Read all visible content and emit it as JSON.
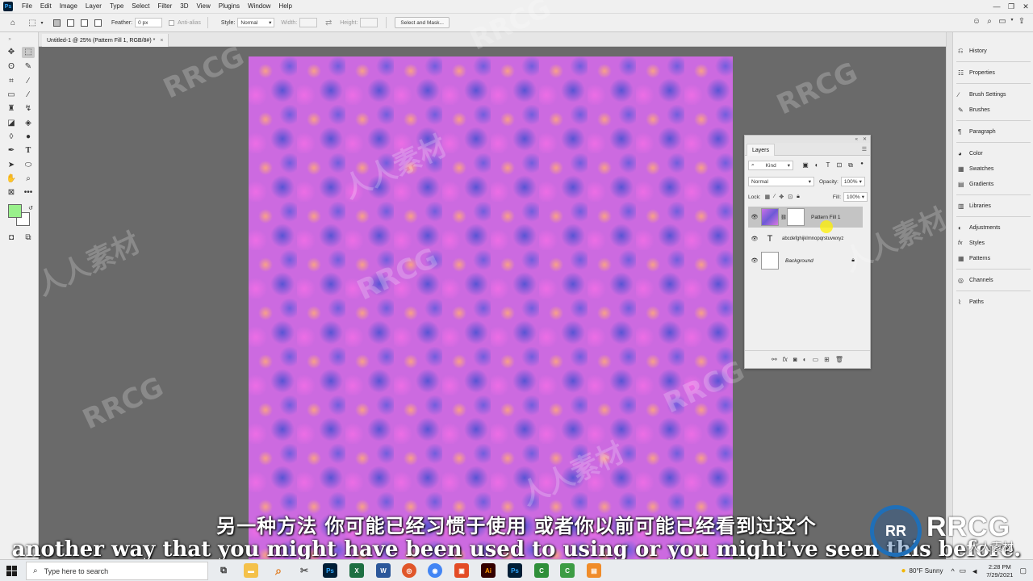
{
  "app": {
    "logo_text": "Ps"
  },
  "menubar": {
    "items": [
      "File",
      "Edit",
      "Image",
      "Layer",
      "Type",
      "Select",
      "Filter",
      "3D",
      "View",
      "Plugins",
      "Window",
      "Help"
    ],
    "window_controls": [
      "—",
      "❐",
      "✕"
    ]
  },
  "options_bar": {
    "feather_label": "Feather:",
    "feather_value": "0 px",
    "antialias_label": "Anti-alias",
    "style_label": "Style:",
    "style_value": "Normal",
    "width_label": "Width:",
    "height_label": "Height:",
    "select_mask_label": "Select and Mask..."
  },
  "document": {
    "tab_title": "Untitled-1 @ 25% (Pattern Fill 1, RGB/8#) *",
    "close": "×"
  },
  "toolbar": {
    "foreground_color": "#99f08b",
    "background_color": "#ffffff"
  },
  "layers_panel": {
    "title": "Layers",
    "filter_label": "Kind",
    "blend_mode": "Normal",
    "opacity_label": "Opacity:",
    "opacity_value": "100%",
    "lock_label": "Lock:",
    "fill_label": "Fill:",
    "fill_value": "100%",
    "layers": [
      {
        "name": "Pattern Fill 1",
        "type": "pattern-fill",
        "selected": true
      },
      {
        "name": "abcdefghijklmnopqrstuvwxyz",
        "type": "text",
        "selected": false
      },
      {
        "name": "Background",
        "type": "background",
        "selected": false,
        "locked": true
      }
    ]
  },
  "right_panels": {
    "groups": [
      [
        "History"
      ],
      [
        "Properties"
      ],
      [
        "Brush Settings",
        "Brushes"
      ],
      [
        "Paragraph"
      ],
      [
        "Color",
        "Swatches",
        "Gradients"
      ],
      [
        "Libraries"
      ],
      [
        "Adjustments",
        "Styles",
        "Patterns"
      ],
      [
        "Channels"
      ],
      [
        "Paths"
      ]
    ]
  },
  "subtitles": {
    "chinese": "另一种方法 你可能已经习惯于使用 或者你以前可能已经看到过这个",
    "english": "another way that you might have been used to using or you might've seen this before."
  },
  "watermark": {
    "text": "RRCG",
    "cn_text": "人人素材",
    "logo_text": "RRCG",
    "logo_sub": "人人素材",
    "logo_mark": "RR"
  },
  "taskbar": {
    "search_placeholder": "Type here to search",
    "weather": "80°F  Sunny",
    "time": "2:28 PM",
    "date": "7/29/2021"
  },
  "colors": {
    "canvas_pink": "#cc6ae0",
    "canvas_blue": "#4650d2",
    "canvas_peach": "#ffaa78",
    "accent": "#1473e6"
  }
}
